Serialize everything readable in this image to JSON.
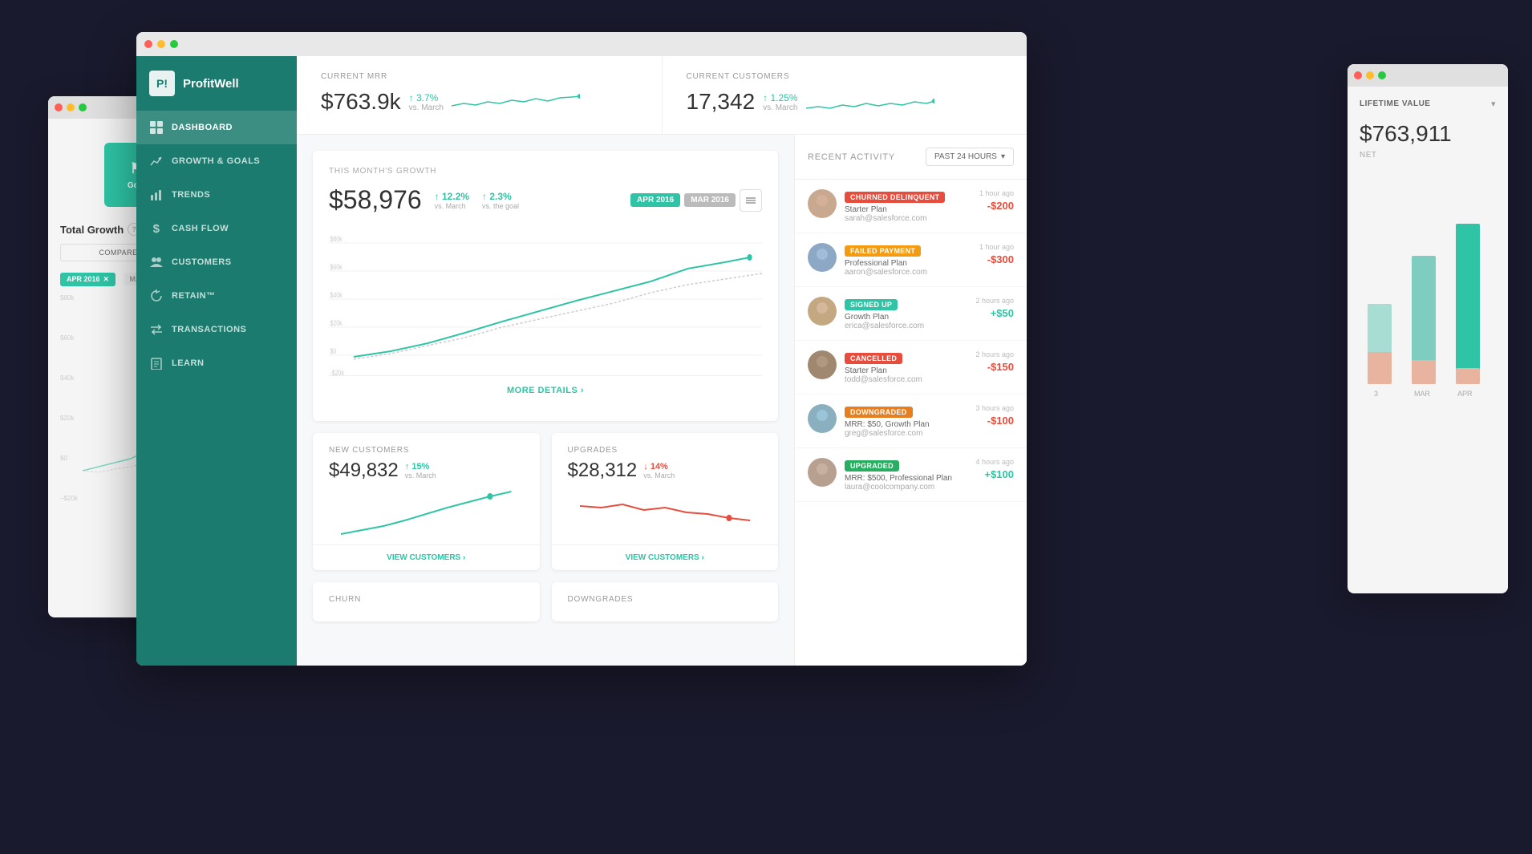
{
  "scene": {
    "title": "ProfitWell Dashboard"
  },
  "leftBgWindow": {
    "totalGrowthLabel": "Total Growth",
    "helpIcon": "?",
    "compareMonthsBtn": "COMPARE MONTHS",
    "aprBadge": "APR 2016",
    "marBadge": "MAR",
    "chartYLabels": [
      "$80k",
      "$60k",
      "$40k",
      "$20k",
      "$0",
      "−$20k"
    ]
  },
  "rightBgWindow": {
    "lifetimeValueLabel": "LIFETIME VALUE",
    "lifetimeValue": "$763,911",
    "netLabel": "NET",
    "barLabels": [
      "3",
      "MAR",
      "APR"
    ]
  },
  "sidebar": {
    "logoText": "ProfitWell",
    "navItems": [
      {
        "id": "dashboard",
        "label": "DASHBOARD",
        "icon": "▦",
        "active": true
      },
      {
        "id": "growth",
        "label": "GROWTH & GOALS",
        "icon": "⚑"
      },
      {
        "id": "trends",
        "label": "TRENDS",
        "icon": "📈"
      },
      {
        "id": "cashflow",
        "label": "CASH FLOW",
        "icon": "$"
      },
      {
        "id": "customers",
        "label": "CUSTOMERS",
        "icon": "👥"
      },
      {
        "id": "retain",
        "label": "RETAIN™",
        "icon": "↻"
      },
      {
        "id": "transactions",
        "label": "TRANSACTIONS",
        "icon": "→"
      },
      {
        "id": "learn",
        "label": "LEARN",
        "icon": "📖"
      }
    ]
  },
  "metricsBar": {
    "currentMrr": {
      "label": "CURRENT MRR",
      "value": "$763.9k",
      "change": "↑ 3.7%",
      "subtitle": "vs. March"
    },
    "currentCustomers": {
      "label": "CURRENT CUSTOMERS",
      "value": "17,342",
      "change": "↑ 1.25%",
      "subtitle": "vs. March"
    }
  },
  "growthCard": {
    "title": "THIS MONTH'S GROWTH",
    "value": "$58,976",
    "change1": "↑ 12.2%",
    "change1Sub": "vs. March",
    "change2": "↑ 2.3%",
    "change2Sub": "vs. the goal",
    "badge1": "APR 2016",
    "badge2": "MAR 2016",
    "moreDetails": "MORE DETAILS ›",
    "yLabels": [
      "$80k",
      "$60k",
      "$40k",
      "$20k",
      "$0",
      "-$20k"
    ]
  },
  "newCustomers": {
    "label": "NEW CUSTOMERS",
    "value": "$49,832",
    "change": "↑ 15%",
    "changeSub": "vs. March",
    "viewBtn": "VIEW CUSTOMERS ›"
  },
  "upgrades": {
    "label": "UPGRADES",
    "value": "$28,312",
    "change": "↓ 14%",
    "changeSub": "vs. March",
    "viewBtn": "VIEW CUSTOMERS ›"
  },
  "churn": {
    "label": "CHURN"
  },
  "downgrades": {
    "label": "DOWNGRADES"
  },
  "recentActivity": {
    "title": "RECENT ACTIVITY",
    "filter": "PAST 24 HOURS",
    "items": [
      {
        "badge": "CHURNED DELINQUENT",
        "badgeType": "churned",
        "plan": "Starter Plan",
        "email": "sarah@salesforce.com",
        "time": "1 hour ago",
        "amount": "-$200",
        "amountType": "negative"
      },
      {
        "badge": "FAILED PAYMENT",
        "badgeType": "failed",
        "plan": "Professional Plan",
        "email": "aaron@salesforce.com",
        "time": "1 hour ago",
        "amount": "-$300",
        "amountType": "negative"
      },
      {
        "badge": "SIGNED UP",
        "badgeType": "signed",
        "plan": "Growth Plan",
        "email": "erica@salesforce.com",
        "time": "2 hours ago",
        "amount": "+$50",
        "amountType": "positive"
      },
      {
        "badge": "CANCELLED",
        "badgeType": "cancelled",
        "plan": "Starter Plan",
        "email": "todd@salesforce.com",
        "time": "2 hours ago",
        "amount": "-$150",
        "amountType": "negative"
      },
      {
        "badge": "DOWNGRADED",
        "badgeType": "downgraded",
        "plan": "MRR: $50, Growth Plan",
        "email": "greg@salesforce.com",
        "time": "3 hours ago",
        "amount": "-$100",
        "amountType": "negative"
      },
      {
        "badge": "UPGRADED",
        "badgeType": "upgraded",
        "plan": "MRR: $500, Professional Plan",
        "email": "laura@coolcompany.com",
        "time": "4 hours ago",
        "amount": "+$100",
        "amountType": "positive"
      }
    ]
  }
}
